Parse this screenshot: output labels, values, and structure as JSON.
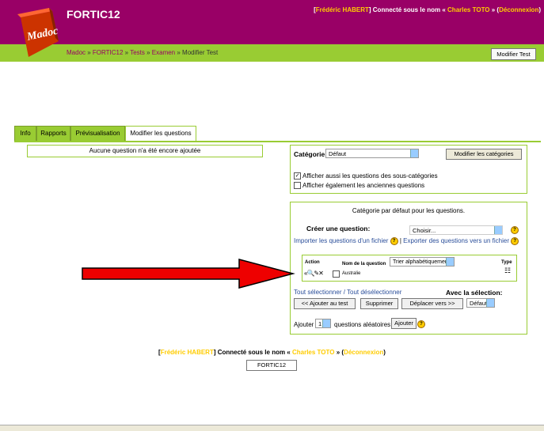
{
  "header": {
    "site_title": "FORTIC12",
    "logo_text": "Madoc",
    "login": {
      "user": "Frédéric HABERT",
      "connected_as_prefix": "] Connecté sous le nom « ",
      "connected_name": "Charles TOTO",
      "suffix": " » (",
      "logout": "Déconnexion",
      "close": ")"
    },
    "breadcrumb": [
      "Madoc",
      "FORTIC12",
      "Tests",
      "Examen",
      "Modifier Test"
    ],
    "breadcrumb_sep": " » ",
    "modify_test_button": "Modifier Test"
  },
  "tabs": [
    "Info",
    "Rapports",
    "Prévisualisation",
    "Modifier les questions"
  ],
  "no_questions_text": "Aucune question n'a été encore ajoutée",
  "category": {
    "label": "Catégorie:",
    "selected": "Défaut",
    "modify_button": "Modifier les catégories",
    "show_subcategories": "Afficher aussi les questions des sous-catégories",
    "show_subcategories_checked": true,
    "show_old": "Afficher également les anciennes questions",
    "show_old_checked": false
  },
  "create_panel": {
    "title": "Catégorie par défaut pour les questions.",
    "create_label": "Créer une question:",
    "create_select": "Choisir...",
    "import_link": "Importer les questions d'un fichier",
    "separator": "|",
    "export_link": "Exporter des questions vers un fichier",
    "table": {
      "col_action": "Action",
      "col_name": "Nom de la question",
      "sort_select": "Trier alphabétiquement",
      "col_type": "Type",
      "rows": [
        {
          "actions": "«🔍✎✕",
          "name": "Australie"
        }
      ]
    },
    "select_all": "Tout sélectionner",
    "slash": " / ",
    "deselect_all": "Tout désélectionner",
    "with_selection": "Avec la sélection:",
    "add_to_test_button": "<< Ajouter au test",
    "delete_button": "Supprimer",
    "move_to_button": "Déplacer vers >>",
    "move_select": "Défaut",
    "add_label": "Ajouter",
    "add_count": "1",
    "random_label": "questions aléatoires",
    "add_button": "Ajouter"
  },
  "footer": {
    "user": "Frédéric HABERT",
    "connected_as_prefix": "] Connecté sous le nom « ",
    "connected_name": "Charles TOTO",
    "suffix": " » (",
    "logout": "Déconnexion",
    "close": ")",
    "course_button": "FORTIC12"
  },
  "colors": {
    "header": "#990066",
    "accent": "#99cc33",
    "arrow": "#ee0000",
    "link": "#2a4e9a"
  }
}
